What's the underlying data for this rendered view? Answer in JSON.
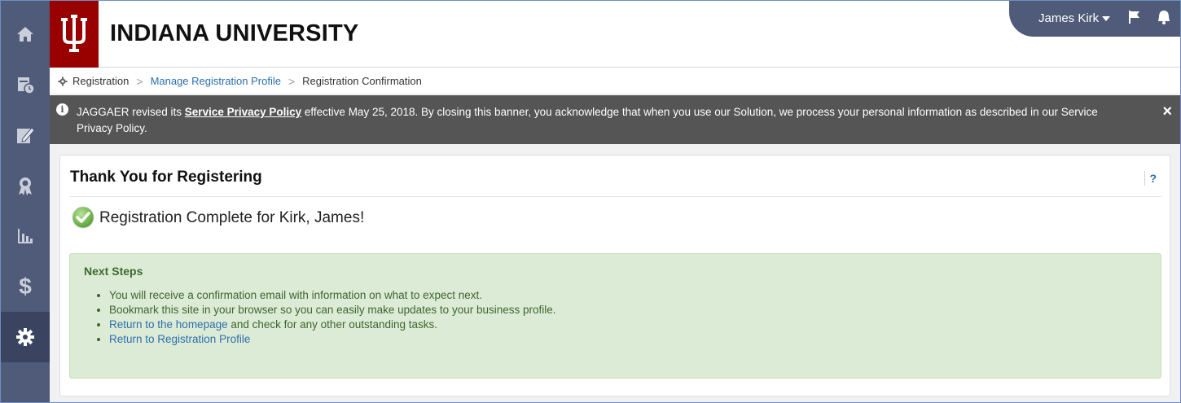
{
  "header": {
    "brand": "INDIANA UNIVERSITY",
    "user_name": "James Kirk"
  },
  "sidebar": {
    "items": [
      {
        "icon": "home-icon",
        "active": false
      },
      {
        "icon": "calendar-document-icon",
        "active": false
      },
      {
        "icon": "edit-document-icon",
        "active": false
      },
      {
        "icon": "award-icon",
        "active": false
      },
      {
        "icon": "bar-chart-icon",
        "active": false
      },
      {
        "icon": "dollar-icon",
        "active": false
      },
      {
        "icon": "gear-icon",
        "active": true
      }
    ]
  },
  "breadcrumb": {
    "items": [
      "Registration",
      "Manage Registration Profile",
      "Registration Confirmation"
    ]
  },
  "banner": {
    "text_before": "JAGGAER revised its ",
    "policy_link": "Service Privacy Policy",
    "text_after": " effective May 25, 2018. By closing this banner, you acknowledge that when you use our Solution, we process your personal information as described in our Service Privacy Policy.",
    "close": "×"
  },
  "panel": {
    "title": "Thank You for Registering",
    "help": "?",
    "complete_message": "Registration Complete for Kirk, James!"
  },
  "next_steps": {
    "title": "Next Steps",
    "items": [
      {
        "text": "You will receive a confirmation email with information on what to expect next."
      },
      {
        "text": "Bookmark this site in your browser so you can easily make updates to your business profile."
      },
      {
        "link": "Return to the homepage",
        "text": " and check for any other outstanding tasks."
      },
      {
        "link": "Return to Registration Profile",
        "text": ""
      }
    ]
  },
  "colors": {
    "sidebar": "#4f5b78",
    "sidebar_active": "#3a4360",
    "brand_red": "#990000",
    "banner": "#555555",
    "next_steps_bg": "#dcebd5",
    "link": "#2b6fad"
  }
}
